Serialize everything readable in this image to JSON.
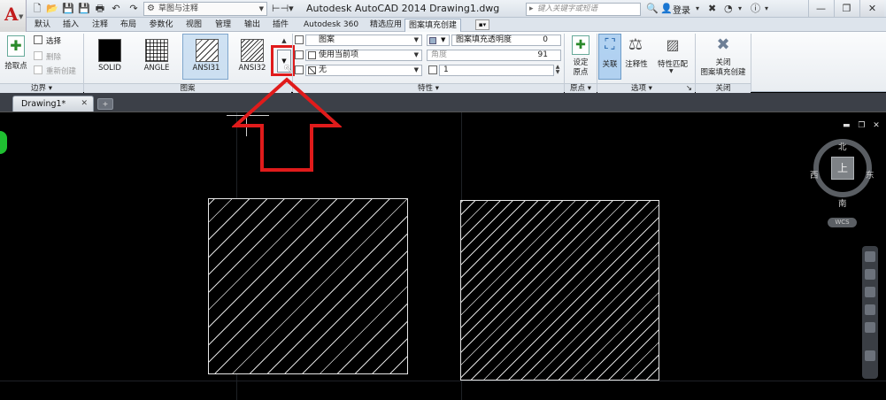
{
  "app": {
    "title": "Autodesk AutoCAD 2014    Drawing1.dwg",
    "workspace": "草图与注释",
    "search_placeholder": "键入关键字或短语",
    "login": "登录"
  },
  "ribbon_tabs": [
    "默认",
    "插入",
    "注释",
    "布局",
    "参数化",
    "视图",
    "管理",
    "输出",
    "插件",
    "Autodesk 360",
    "精选应用",
    "图案填充创建"
  ],
  "panels": {
    "boundary": {
      "title": "边界",
      "pick_points": "拾取点",
      "select": "选择",
      "remove": "删除",
      "recreate": "重新创建"
    },
    "pattern": {
      "title": "图案",
      "items": [
        "SOLID",
        "ANGLE",
        "ANSI31",
        "ANSI32"
      ]
    },
    "properties": {
      "title": "特性",
      "type_value": "图案",
      "color_value": "使用当前项",
      "background_value": "无",
      "transparency_label": "图案填充透明度",
      "transparency_value": "0",
      "angle_label": "角度",
      "angle_value": "91",
      "scale_value": "1"
    },
    "origin": {
      "title": "原点",
      "set_origin": "设定\n原点"
    },
    "options": {
      "title": "选项",
      "associative": "关联",
      "annotative": "注释性",
      "match_properties": "特性匹配"
    },
    "close": {
      "title": "关闭",
      "close_label": "关闭\n图案填充创建"
    }
  },
  "document": {
    "tab_label": "Drawing1*"
  },
  "viewcube": {
    "north": "北",
    "south": "南",
    "east": "东",
    "west": "西",
    "top_face": "上",
    "wcs": "WCS"
  },
  "colors": {
    "highlight": "#e01b1b",
    "canvas": "#000000",
    "active_tab": "#f3f6f9"
  }
}
